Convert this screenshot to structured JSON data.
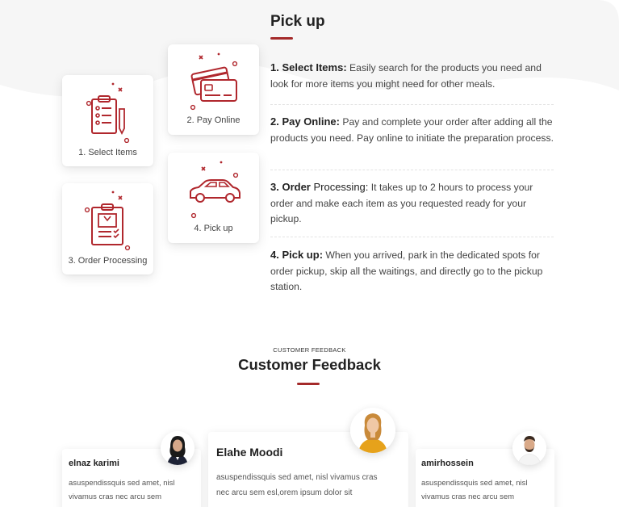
{
  "pickup": {
    "title": "Pick up",
    "cards": [
      {
        "label": "1. Select Items",
        "icon": "clipboard-list-icon"
      },
      {
        "label": "2. Pay Online",
        "icon": "credit-card-icon"
      },
      {
        "label": "3. Order Processing",
        "icon": "order-clipboard-icon"
      },
      {
        "label": "4. Pick up",
        "icon": "car-icon"
      }
    ],
    "steps": [
      {
        "head": "1. Select Items:",
        "text": " Easily search for the products you need and look for more items you might need for other meals."
      },
      {
        "head": "2. Pay Online:",
        "text": " Pay and complete your order after adding all the products you need. Pay online to initiate the preparation process."
      },
      {
        "head": "3. Order",
        "head2": " Processing:",
        "text": " It takes up to 2 hours to process your order and make each item as you requested ready for your pickup."
      },
      {
        "head": "4. Pick up:",
        "text": " When you arrived, park in the dedicated spots for order pickup, skip all the waitings, and directly go to the pickup station."
      }
    ]
  },
  "feedback": {
    "eyebrow": "CUSTOMER FEEDBACK",
    "title": "Customer Feedback",
    "reviews": [
      {
        "name": "elnaz karimi",
        "line1": "asuspendissquis sed amet, nisl",
        "line2": "vivamus cras nec arcu sem"
      },
      {
        "name": "Elahe Moodi",
        "line1": "asuspendissquis sed amet, nisl vivamus cras",
        "line2": "nec arcu sem esl,orem ipsum dolor sit"
      },
      {
        "name": "amirhossein",
        "line1": "asuspendissquis sed amet, nisl",
        "line2": "vivamus cras nec arcu sem"
      }
    ]
  },
  "colors": {
    "accent": "#a42a2a",
    "icon": "#b0272d"
  }
}
